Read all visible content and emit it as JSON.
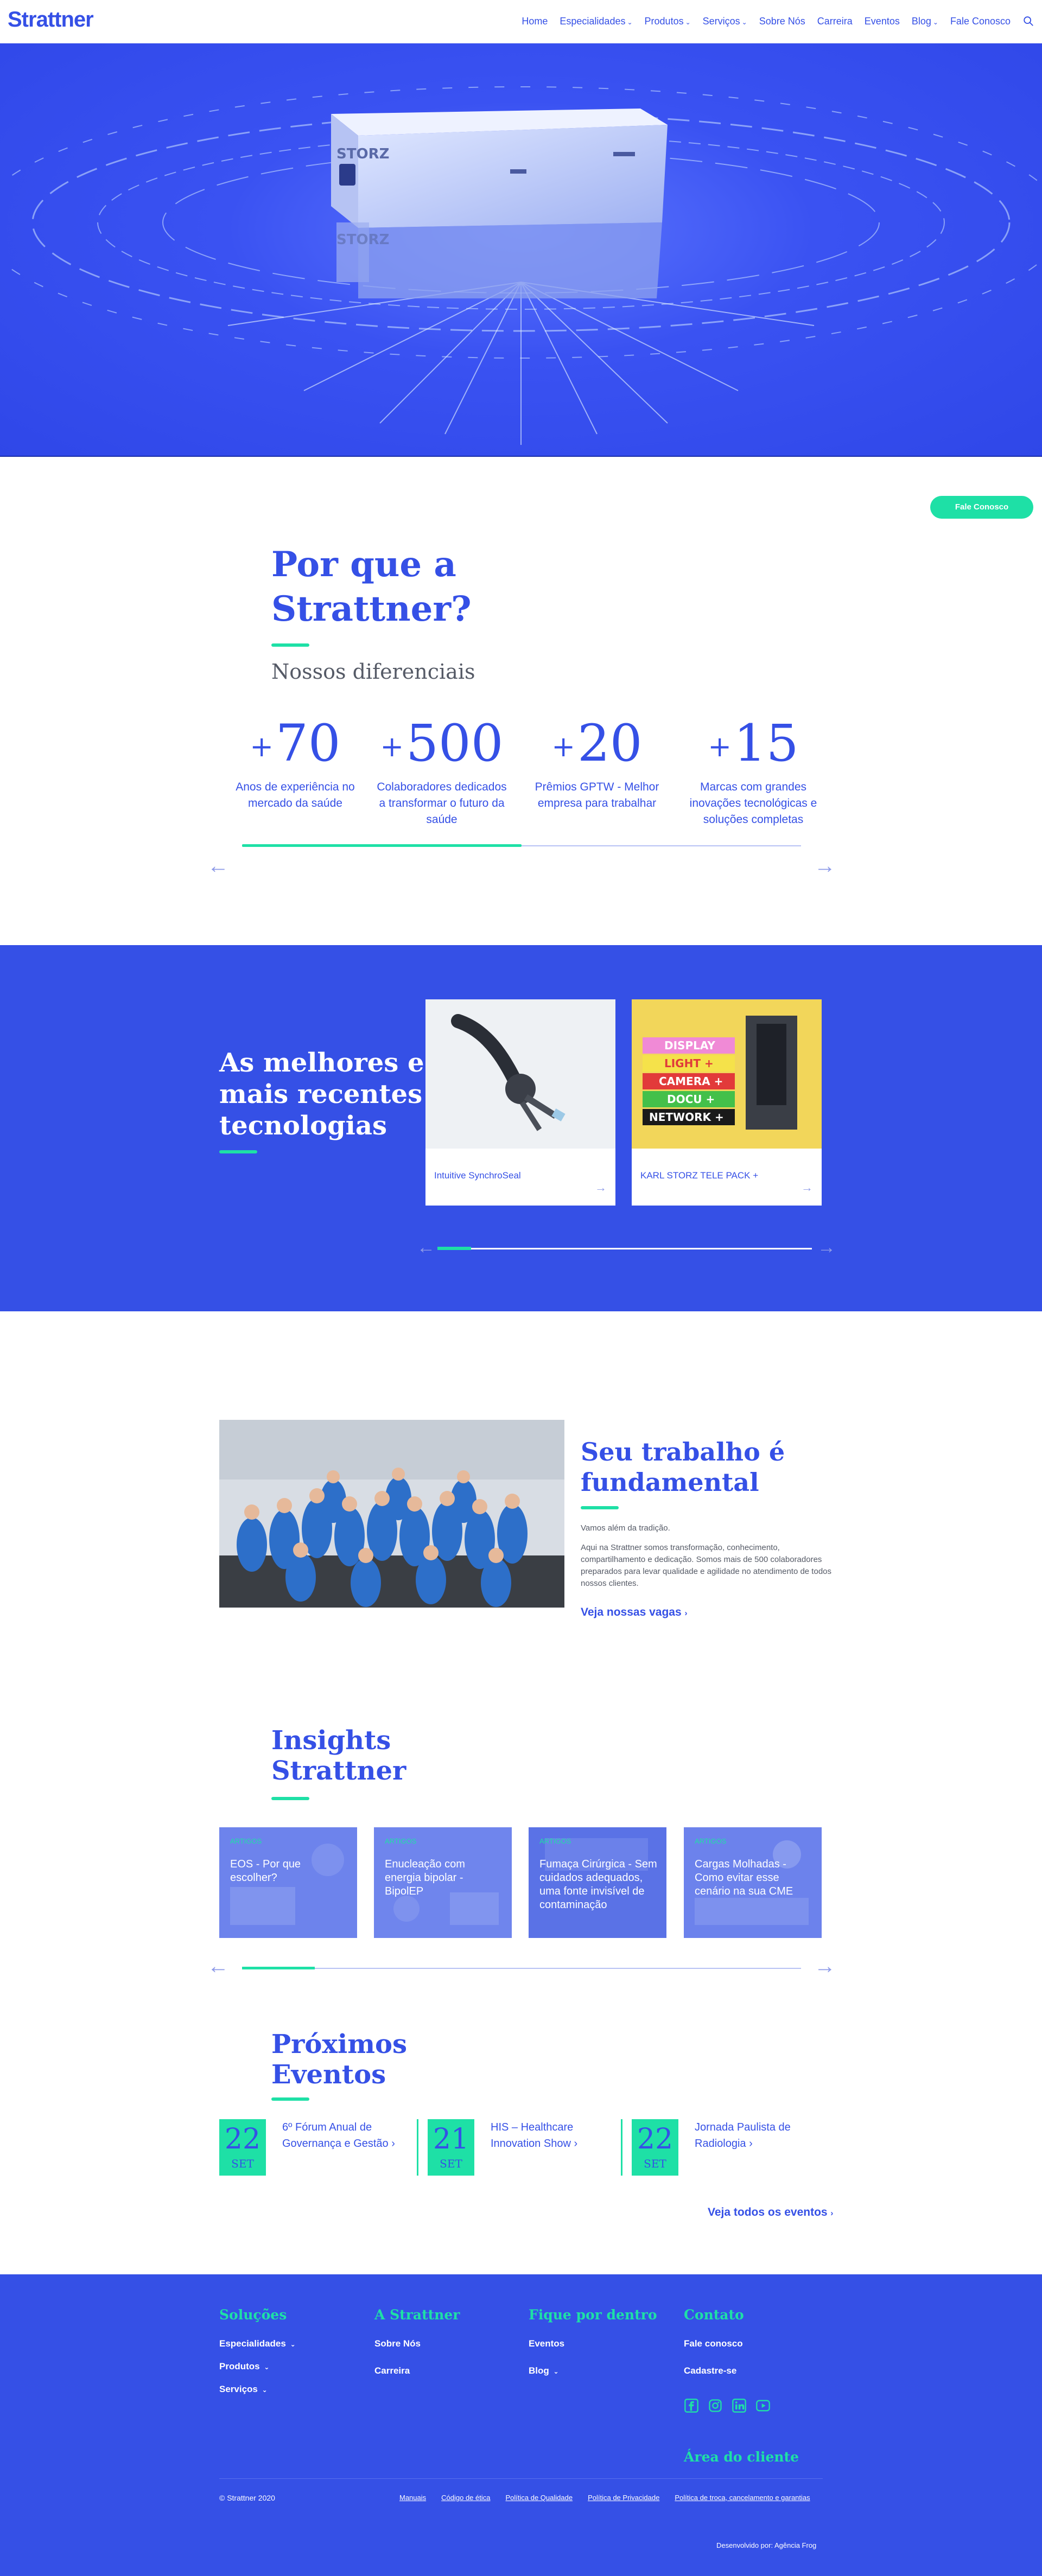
{
  "header": {
    "logo": "Strattner",
    "nav": [
      {
        "label": "Home",
        "dropdown": false
      },
      {
        "label": "Especialidades",
        "dropdown": true
      },
      {
        "label": "Produtos",
        "dropdown": true
      },
      {
        "label": "Serviços",
        "dropdown": true
      },
      {
        "label": "Sobre Nós",
        "dropdown": false
      },
      {
        "label": "Carreira",
        "dropdown": false
      },
      {
        "label": "Eventos",
        "dropdown": false
      },
      {
        "label": "Blog",
        "dropdown": true
      },
      {
        "label": "Fale Conosco",
        "dropdown": false
      }
    ],
    "search_icon": "search-icon"
  },
  "hero": {
    "device_brand": "STORZ",
    "colors": {
      "background": "#3550e6",
      "accent": "#1ee0a6"
    }
  },
  "cta": {
    "label": "Fale Conosco"
  },
  "why": {
    "title": "Por que a Strattner?",
    "subtitle": "Nossos diferenciais",
    "stats": [
      {
        "plus": "+",
        "number": "70",
        "label": "Anos de experiência no mercado da saúde"
      },
      {
        "plus": "+",
        "number": "500",
        "label": "Colaboradores dedicados a transformar o futuro da saúde"
      },
      {
        "plus": "+",
        "number": "20",
        "label": "Prêmios GPTW - Melhor empresa para trabalhar"
      },
      {
        "plus": "+",
        "number": "15",
        "label": "Marcas com grandes inovações tecnológicas e soluções completas"
      }
    ],
    "progress": 0.5
  },
  "tech": {
    "title": "As melhores e mais recentes tecnologias",
    "cards": [
      {
        "label": "Intuitive SynchroSeal"
      },
      {
        "label": "KARL STORZ TELE PACK +",
        "screen_lines": [
          "DISPLAY",
          "LIGHT +",
          "CAMERA +",
          "DOCU +",
          "NETWORK +"
        ]
      }
    ],
    "progress": 0.09
  },
  "work": {
    "title": "Seu trabalho é fundamental",
    "intro": "Vamos além da tradição.",
    "body": "Aqui na Strattner somos transformação, conhecimento, compartilhamento e dedicação. Somos mais de 500 colaboradores preparados para levar qualidade e agilidade no atendimento de todos nossos clientes.",
    "link": "Veja nossas vagas"
  },
  "insights": {
    "title": "Insights Strattner",
    "cards": [
      {
        "tag": "ARTIGOS",
        "title": "EOS - Por que escolher?"
      },
      {
        "tag": "ARTIGOS",
        "title": "Enucleação com energia bipolar - BipolEP"
      },
      {
        "tag": "ARTIGOS",
        "title": "Fumaça Cirúrgica - Sem cuidados adequados, uma fonte invisível de contaminação"
      },
      {
        "tag": "ARTIGOS",
        "title": "Cargas Molhadas - Como evitar esse cenário na sua CME"
      }
    ],
    "progress": 0.13
  },
  "events": {
    "title": "Próximos Eventos",
    "items": [
      {
        "day": "22",
        "month": "SET",
        "name": "6º Fórum Anual de Governança e Gestão"
      },
      {
        "day": "21",
        "month": "SET",
        "name": "HIS – Healthcare Innovation Show"
      },
      {
        "day": "22",
        "month": "SET",
        "name": "Jornada Paulista de Radiologia"
      }
    ],
    "link": "Veja todos os eventos"
  },
  "footer": {
    "columns": [
      {
        "heading": "Soluções",
        "links": [
          "Especialidades",
          "Produtos",
          "Serviços"
        ],
        "dropdowns": [
          true,
          true,
          true
        ]
      },
      {
        "heading": "A Strattner",
        "links": [
          "Sobre Nós",
          "Carreira"
        ],
        "dropdowns": [
          false,
          false
        ]
      },
      {
        "heading": "Fique por dentro",
        "links": [
          "Eventos",
          "Blog"
        ],
        "dropdowns": [
          false,
          true
        ]
      },
      {
        "heading": "Contato",
        "links": [
          "Fale conosco",
          "Cadastre-se"
        ],
        "dropdowns": [
          false,
          false
        ]
      }
    ],
    "social_icons": [
      "facebook-icon",
      "instagram-icon",
      "linkedin-icon",
      "youtube-icon"
    ],
    "client_area": "Área do cliente",
    "copyright": "© Strattner 2020",
    "legal": [
      "Manuais",
      "Código de ética",
      "Política de Qualidade",
      "Política de Privacidade",
      "Política de troca, cancelamento e garantias"
    ],
    "credit": "Desenvolvido por: Agência Frog"
  }
}
